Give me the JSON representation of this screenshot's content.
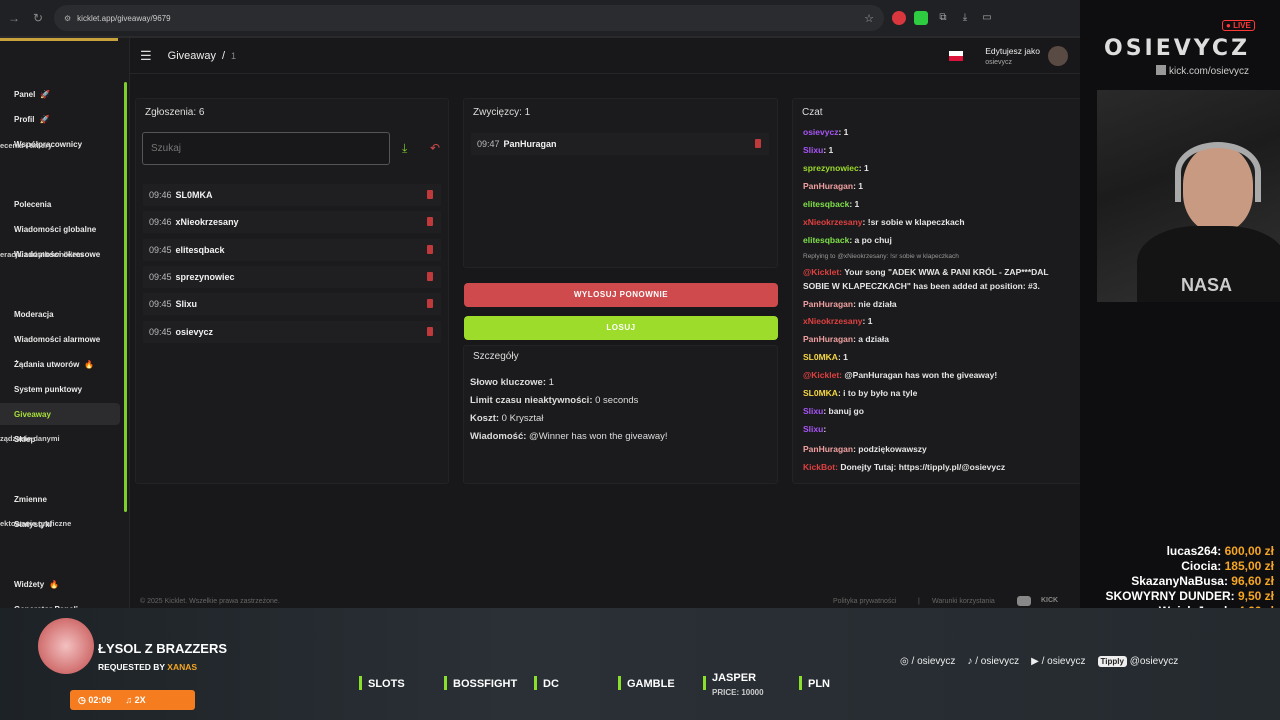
{
  "browser": {
    "url": "kicklet.app/giveaway/9679"
  },
  "sidebar": {
    "items": [
      {
        "label": "Panel",
        "badge": "🚀"
      },
      {
        "label": "Profil",
        "badge": "🚀"
      },
      {
        "label": "Współpracownicy",
        "badge": ""
      },
      {
        "label": "Polecenia",
        "badge": ""
      },
      {
        "label": "Wiadomości globalne",
        "badge": ""
      },
      {
        "label": "Wiadomości okresowe",
        "badge": ""
      },
      {
        "label": "Moderacja",
        "badge": ""
      },
      {
        "label": "Wiadomości alarmowe",
        "badge": ""
      },
      {
        "label": "Żądania utworów",
        "badge": "🔥"
      },
      {
        "label": "System punktowy",
        "badge": ""
      },
      {
        "label": "Giveaway",
        "badge": ""
      },
      {
        "label": "Sklep",
        "badge": ""
      },
      {
        "label": "Zmienne",
        "badge": ""
      },
      {
        "label": "Statystyki",
        "badge": ""
      },
      {
        "label": "Widżety",
        "badge": "🔥"
      },
      {
        "label": "Generator Paneli",
        "badge": ""
      },
      {
        "label": "Generator Emotek",
        "badge": ""
      }
    ],
    "sections": [
      "ecenia i timery",
      "eracja z użytkownikiem",
      "ządzanie danymi",
      "ektowanie graficzne"
    ]
  },
  "header": {
    "breadcrumb": "Giveaway",
    "separator": "/",
    "current": "1",
    "editing_label": "Edytujesz jako",
    "editing_user": "osievycz"
  },
  "entries": {
    "title": "Zgłoszenia: 6",
    "search_placeholder": "Szukaj",
    "rows": [
      {
        "time": "09:46",
        "name": "SL0MKA"
      },
      {
        "time": "09:46",
        "name": "xNieokrzesany"
      },
      {
        "time": "09:45",
        "name": "elitesqback"
      },
      {
        "time": "09:45",
        "name": "sprezynowiec"
      },
      {
        "time": "09:45",
        "name": "Slixu"
      },
      {
        "time": "09:45",
        "name": "osievycz"
      }
    ]
  },
  "winners": {
    "title": "Zwycięzcy: 1",
    "rows": [
      {
        "time": "09:47",
        "name": "PanHuragan"
      }
    ],
    "reroll_label": "WYLOSUJ PONOWNIE",
    "draw_label": "LOSUJ"
  },
  "details": {
    "title": "Szczegóły",
    "keyword_label": "Słowo kluczowe:",
    "keyword_value": "1",
    "inactivity_label": "Limit czasu nieaktywności:",
    "inactivity_value": "0 seconds",
    "cost_label": "Koszt:",
    "cost_value": "0 Kryształ",
    "message_label": "Wiadomość:",
    "message_value": "@Winner has won the giveaway!"
  },
  "chat": {
    "title": "Czat",
    "lines": [
      {
        "user": "osievycz",
        "color": "#a855f7",
        "text": "1"
      },
      {
        "user": "Slixu",
        "color": "#a855f7",
        "text": "1"
      },
      {
        "user": "sprezynowiec",
        "color": "#9ddc2b",
        "text": "1"
      },
      {
        "user": "PanHuragan",
        "color": "#f0a0a0",
        "text": "1"
      },
      {
        "user": "elitesqback",
        "color": "#7fe04a",
        "text": "1"
      },
      {
        "user": "xNieokrzesany",
        "color": "#e04040",
        "text": "!sr sobie w klapeczkach"
      },
      {
        "user": "elitesqback",
        "color": "#7fe04a",
        "text": "a po chuj"
      },
      {
        "user": "",
        "color": "#999999",
        "text": "Replying to @xNieokrzesany: !sr sobie w klapeczkach"
      },
      {
        "user": "@Kicklet",
        "color": "#e04040",
        "text": "Your song \"ADEK WWA & PANI KRÓL - ZAP***DAL"
      },
      {
        "user": "",
        "color": "#e6e6e6",
        "text": "SOBIE W KLAPECZKACH\" has been added at position: #3."
      },
      {
        "user": "PanHuragan",
        "color": "#f0a0a0",
        "text": "nie działa"
      },
      {
        "user": "xNieokrzesany",
        "color": "#e04040",
        "text": "1"
      },
      {
        "user": "PanHuragan",
        "color": "#f0a0a0",
        "text": "a działa"
      },
      {
        "user": "SL0MKA",
        "color": "#f5d742",
        "text": "1"
      },
      {
        "user": "@Kicklet",
        "color": "#e04040",
        "text": "@PanHuragan has won the giveaway!"
      },
      {
        "user": "SL0MKA",
        "color": "#f5d742",
        "text": "i to by było na tyle"
      },
      {
        "user": "Slixu",
        "color": "#a855f7",
        "text": "banuj go"
      },
      {
        "user": "Slixu",
        "color": "#a855f7",
        "text": ""
      },
      {
        "user": "PanHuragan",
        "color": "#f0a0a0",
        "text": "podziękowawszy"
      },
      {
        "user": "KickBot",
        "color": "#e04040",
        "text": "Donejty Tutaj: https://tipply.pl/@osievycz"
      }
    ]
  },
  "footer": {
    "copyright": "© 2025 Kicklet. Wszelkie prawa zastrzeżone.",
    "privacy": "Polityka prywatności",
    "terms": "Warunki korzystania"
  },
  "stream": {
    "live_badge": "LIVE",
    "channel_logo": "OSIEVYCZ",
    "channel_url": "kick.com/osievycz",
    "donors": [
      {
        "name": "lucas264:",
        "amount": "600,00 zł"
      },
      {
        "name": "Ciocia:",
        "amount": "185,00 zł"
      },
      {
        "name": "SkazanyNaBusa:",
        "amount": "96,60 zł"
      },
      {
        "name": "SKOWYRNY DUNDER:",
        "amount": "9,50 zł"
      },
      {
        "name": "Wujek Jacek:",
        "amount": "4,66 zł"
      }
    ],
    "song_title": "ŁYSOL Z BRAZZERS",
    "requested_by_label": "REQUESTED BY",
    "requested_by_user": "XANAS",
    "song_time": "02:09",
    "song_count": "2X",
    "commands": [
      "SLOTS",
      "BOSSFIGHT",
      "DC",
      "GAMBLE",
      "JASPER",
      "PLN"
    ],
    "jasper_sub": "PRICE: 10000",
    "socials": [
      "/ osievycz",
      "/ osievycz",
      "/ osievycz",
      "@osievycz"
    ],
    "tipply_label": "Tipply"
  }
}
